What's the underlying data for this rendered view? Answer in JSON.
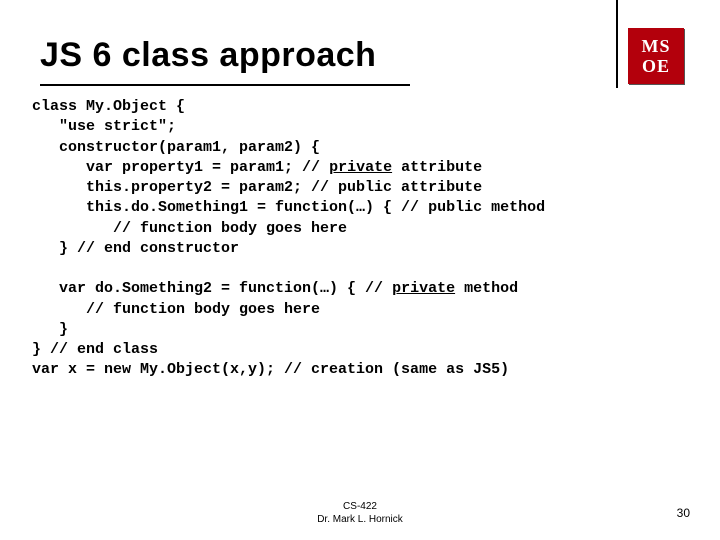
{
  "slide": {
    "title": "JS 6 class approach",
    "logo": {
      "top": "MS",
      "bottom": "OE"
    }
  },
  "code": {
    "l1a": "class My.Object {",
    "l2a": "   \"use strict\";",
    "l3a": "   constructor(param1, param2) {",
    "l4a": "      var property1 = param1; // ",
    "l4u": "private",
    "l4b": " attribute",
    "l5a": "      this.property2 = param2; // public attribute",
    "l6a": "      this.do.Something1 = function(…) { // public method",
    "l7a": "         // function body goes here",
    "l8a": "   } // end constructor",
    "blank": "",
    "l9a": "   var do.Something2 = function(…) { // ",
    "l9u": "private",
    "l9b": " method",
    "l10a": "      // function body goes here",
    "l11a": "   }",
    "l12a": "} // end class",
    "l13a": "var x = new My.Object(x,y); // creation (same as JS5)"
  },
  "footer": {
    "course": "CS-422",
    "author": "Dr. Mark L. Hornick",
    "page": "30"
  }
}
